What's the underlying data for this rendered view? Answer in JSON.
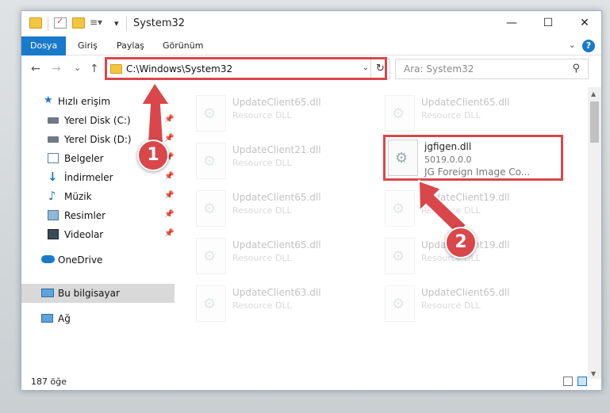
{
  "window": {
    "title": "System32",
    "minimize": "—",
    "maximize": "☐",
    "close": "✕"
  },
  "ribbon": {
    "tabs": [
      "Dosya",
      "Giriş",
      "Paylaş",
      "Görünüm"
    ],
    "help": "?"
  },
  "nav": {
    "back": "←",
    "forward": "→",
    "recent": "⌄",
    "up": "↑",
    "address": "C:\\Windows\\System32",
    "refresh": "↻",
    "search_placeholder": "Ara: System32"
  },
  "sidebar": {
    "items": [
      {
        "label": "Hızlı erişim",
        "icon": "star-icon"
      },
      {
        "label": "Yerel Disk (C:)",
        "icon": "drive-icon",
        "pinned": true
      },
      {
        "label": "Yerel Disk (D:)",
        "icon": "drive-icon",
        "pinned": true
      },
      {
        "label": "Belgeler",
        "icon": "documents-icon",
        "pinned": true
      },
      {
        "label": "İndirmeler",
        "icon": "download-icon",
        "pinned": true
      },
      {
        "label": "Müzik",
        "icon": "music-icon",
        "pinned": true
      },
      {
        "label": "Resimler",
        "icon": "pictures-icon",
        "pinned": true
      },
      {
        "label": "Videolar",
        "icon": "video-icon",
        "pinned": true
      },
      {
        "label": "OneDrive",
        "icon": "cloud-icon"
      },
      {
        "label": "Bu bilgisayar",
        "icon": "computer-icon",
        "selected": true
      },
      {
        "label": "Ağ",
        "icon": "network-icon"
      }
    ]
  },
  "files": [
    {
      "name": "UpdateClient65.dll",
      "desc": "Resource DLL"
    },
    {
      "name": "UpdateClient65.dll",
      "desc": "Resource DLL"
    },
    {
      "name": "UpdateClient21.dll",
      "desc": "Resource DLL"
    },
    {
      "name": "jgfigen.dll",
      "desc": "5019.0.0.0",
      "desc2": "JG Foreign Image Co...",
      "highlighted": true
    },
    {
      "name": "UpdateClient65.dll",
      "desc": "Resource DLL"
    },
    {
      "name": "UpdateClient19.dll",
      "desc": "Resource DLL"
    },
    {
      "name": "UpdateClient65.dll",
      "desc": "Resource DLL"
    },
    {
      "name": "UpdateClient19.dll",
      "desc": "Resource DLL"
    },
    {
      "name": "UpdateClient63.dll",
      "desc": "Resource DLL"
    },
    {
      "name": "UpdateClient65.dll",
      "desc": "Resource DLL"
    }
  ],
  "status": {
    "count": "187 öğe"
  },
  "annotations": {
    "step1": "1",
    "step2": "2",
    "color": "#d9474b"
  }
}
